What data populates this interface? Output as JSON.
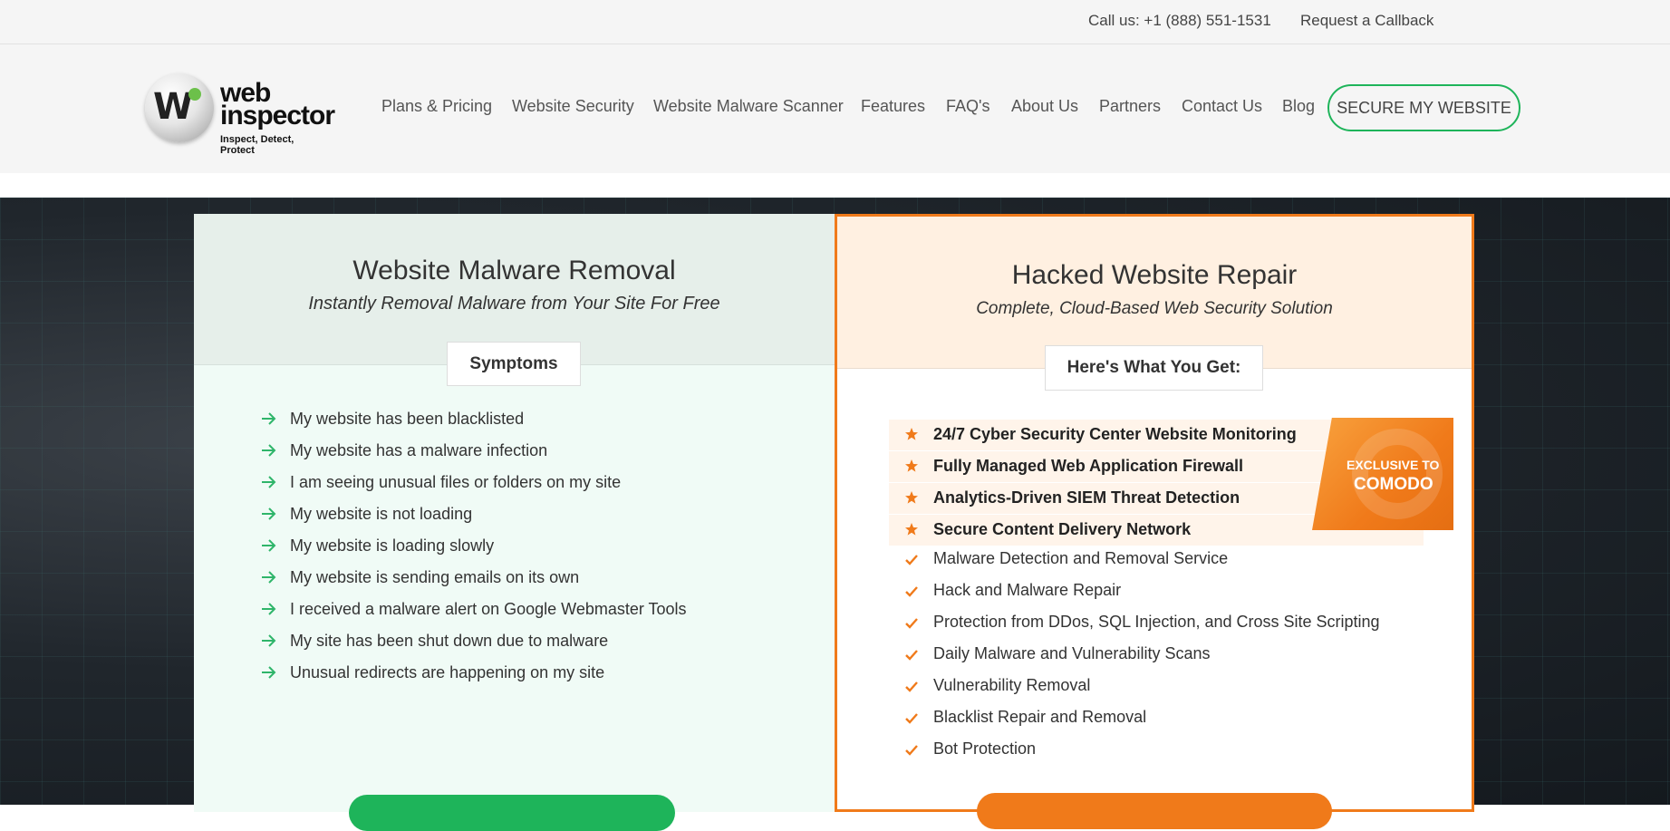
{
  "topbar": {
    "call": "Call us: +1 (888) 551-1531",
    "callback": "Request a Callback"
  },
  "logo": {
    "line1": "web",
    "line2": "inspector",
    "tagline": "Inspect, Detect, Protect"
  },
  "nav": {
    "items": [
      "Plans & Pricing",
      "Website Security",
      "Website Malware Scanner",
      "Features",
      "FAQ's",
      "About Us",
      "Partners",
      "Contact Us",
      "Blog"
    ],
    "cta": "SECURE MY WEBSITE"
  },
  "left_card": {
    "title": "Website Malware Removal",
    "subtitle": "Instantly Removal Malware from Your Site For Free",
    "pill": "Symptoms",
    "items": [
      "My website has been blacklisted",
      "My website has a malware infection",
      "I am seeing unusual files or folders on my site",
      "My website is not loading",
      "My website is loading slowly",
      "My website is sending emails on its own",
      "I received a malware alert on Google Webmaster Tools",
      "My site has been shut down due to malware",
      "Unusual redirects are happening on my site"
    ]
  },
  "right_card": {
    "title": "Hacked Website Repair",
    "subtitle": "Complete, Cloud-Based Web Security Solution",
    "pill": "Here's What You Get:",
    "featured": [
      "24/7 Cyber Security Center Website Monitoring",
      "Fully Managed Web Application Firewall",
      "Analytics-Driven SIEM Threat Detection",
      "Secure Content Delivery Network"
    ],
    "items": [
      "Malware Detection and Removal Service",
      "Hack and Malware Repair",
      "Protection from DDos, SQL Injection, and Cross Site Scripting",
      "Daily Malware and Vulnerability Scans",
      "Vulnerability Removal",
      "Blacklist Repair and Removal",
      "Bot Protection"
    ],
    "badge_line1": "EXCLUSIVE TO",
    "badge_line2": "COMODO"
  },
  "colors": {
    "accent_green": "#1eb45a",
    "accent_orange": "#f07a1a"
  },
  "icons": {
    "symptom_bullet": "arrow-right-icon",
    "featured_bullet": "star-icon",
    "item_bullet": "checkmark-icon"
  }
}
